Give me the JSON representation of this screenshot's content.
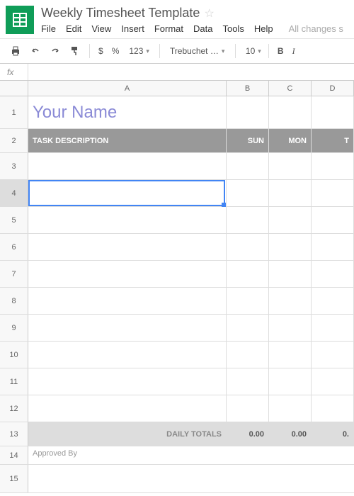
{
  "doc": {
    "title": "Weekly Timesheet Template",
    "save_status": "All changes s"
  },
  "menus": [
    "File",
    "Edit",
    "View",
    "Insert",
    "Format",
    "Data",
    "Tools",
    "Help"
  ],
  "toolbar": {
    "currency": "$",
    "percent": "%",
    "decimals": "123",
    "font": "Trebuchet …",
    "font_size": "10",
    "bold": "B",
    "italic": "I"
  },
  "fx": {
    "label": "fx"
  },
  "columns": [
    "A",
    "B",
    "C",
    "D"
  ],
  "sheet": {
    "name_cell": "Your Name",
    "header": {
      "task": "TASK DESCRIPTION",
      "sun": "SUN",
      "mon": "MON",
      "tue": "T"
    },
    "totals_label": "DAILY TOTALS",
    "totals": {
      "sun": "0.00",
      "mon": "0.00",
      "tue": "0."
    },
    "approved": "Approved By"
  },
  "row_numbers": [
    "1",
    "2",
    "3",
    "4",
    "5",
    "6",
    "7",
    "8",
    "9",
    "10",
    "11",
    "12",
    "13",
    "14",
    "15"
  ],
  "selected": {
    "row": 4,
    "col": "A"
  }
}
